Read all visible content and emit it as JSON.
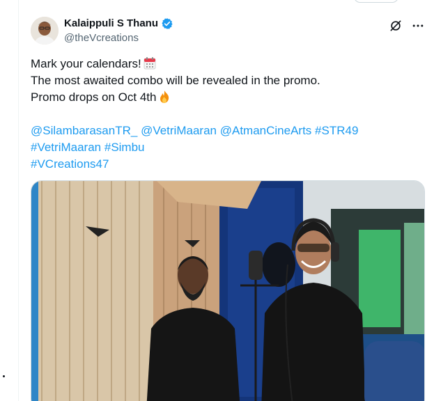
{
  "tweet": {
    "author": {
      "display_name": "Kalaippuli S Thanu",
      "handle": "@theVcreations",
      "verified": true
    },
    "actions": {
      "grok_icon": "grok-icon",
      "more_icon": "more-icon"
    },
    "text": {
      "line1": "Mark your calendars!",
      "line2": "The most awaited combo will be revealed in the promo.",
      "line3": "Promo drops on Oct 4th",
      "mentions": [
        "@SilambarasanTR_",
        "@VetriMaaran",
        "@AtmanCineArts"
      ],
      "hashtags": [
        "#STR49",
        "#VetriMaaran",
        "#Simbu",
        "#VCreations47"
      ]
    },
    "emojis": [
      "calendar-icon",
      "fire-icon"
    ],
    "colors": {
      "link": "#1d9bf0",
      "text": "#0f1419",
      "secondary": "#536471",
      "verified": "#1d9bf0"
    },
    "media": {
      "type": "photo",
      "description_icon": "studio-photo"
    }
  }
}
